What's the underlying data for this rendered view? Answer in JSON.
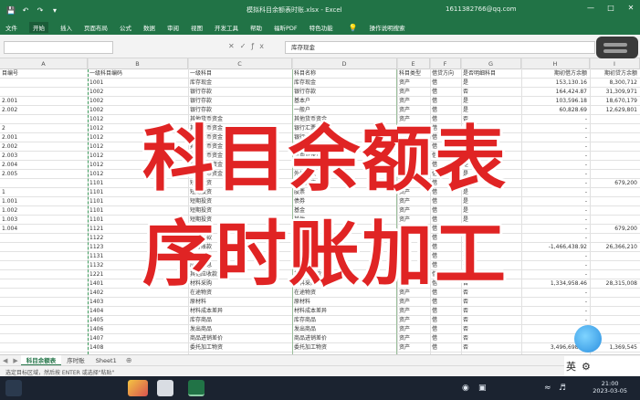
{
  "window": {
    "title": "模拟科目余额表时账.xlsx - Excel",
    "user": "1611382766@qq.com"
  },
  "ribbon": {
    "tabs": [
      "文件",
      "开始",
      "插入",
      "页面布局",
      "公式",
      "数据",
      "审阅",
      "视图",
      "开发工具",
      "帮助",
      "福昕PDF",
      "特色功能",
      "操作说明搜索"
    ]
  },
  "formula_bar": {
    "value": "库存现金"
  },
  "columns": [
    "A",
    "B",
    "C",
    "D",
    "E",
    "F",
    "G",
    "H",
    "I"
  ],
  "grid": {
    "rows": [
      [
        "目编号",
        "一级科目编码",
        "一级科目",
        "科目名称",
        "科目类型",
        "借贷方向",
        "是否明细科目",
        "期初借方余额",
        "期初贷方余额"
      ],
      [
        "",
        "1001",
        "库存现金",
        "库存现金",
        "资产",
        "借",
        "是",
        "153,130.16",
        "8,300,712"
      ],
      [
        "",
        "1002",
        "银行存款",
        "银行存款",
        "资产",
        "借",
        "否",
        "164,424.87",
        "31,309,971"
      ],
      [
        "2.001",
        "1002",
        "银行存款",
        "基本户",
        "资产",
        "借",
        "是",
        "103,596.18",
        "18,670,179"
      ],
      [
        "2.002",
        "1002",
        "银行存款",
        "一般户",
        "资产",
        "借",
        "是",
        "60,828.69",
        "12,629,801"
      ],
      [
        "",
        "1012",
        "其他货币资金",
        "其他货币资金",
        "资产",
        "借",
        "否",
        "-",
        ""
      ],
      [
        "2",
        "1012",
        "其他货币资金",
        "银行汇票",
        "资产",
        "借",
        "是",
        "-",
        ""
      ],
      [
        "2.001",
        "1012",
        "其他货币资金",
        "银行本票",
        "资产",
        "借",
        "是",
        "-",
        ""
      ],
      [
        "2.002",
        "1012",
        "其他货币资金",
        "信用卡存款",
        "资产",
        "借",
        "是",
        "-",
        ""
      ],
      [
        "2.003",
        "1012",
        "其他货币资金",
        "信用证保证金",
        "资产",
        "借",
        "是",
        "-",
        ""
      ],
      [
        "2.004",
        "1012",
        "其他货币资金",
        "存出投资款",
        "资产",
        "借",
        "是",
        "-",
        ""
      ],
      [
        "2.005",
        "1012",
        "其他货币资金",
        "外埠存款",
        "资产",
        "借",
        "是",
        "-",
        ""
      ],
      [
        "",
        "1101",
        "短期投资",
        "短期投资",
        "资产",
        "借",
        "否",
        "-",
        "679,200"
      ],
      [
        "1",
        "1101",
        "短期投资",
        "股票",
        "资产",
        "借",
        "是",
        "-",
        ""
      ],
      [
        "1.001",
        "1101",
        "短期投资",
        "债券",
        "资产",
        "借",
        "是",
        "-",
        ""
      ],
      [
        "1.002",
        "1101",
        "短期投资",
        "基金",
        "资产",
        "借",
        "是",
        "-",
        ""
      ],
      [
        "1.003",
        "1101",
        "短期投资",
        "其他",
        "资产",
        "借",
        "是",
        "-",
        ""
      ],
      [
        "1.004",
        "1121",
        "应收票据",
        "应收票据",
        "资产",
        "借",
        "否",
        "-",
        "679,200"
      ],
      [
        "",
        "1122",
        "应收账款",
        "应收账款",
        "资产",
        "借",
        "否",
        "-",
        ""
      ],
      [
        "",
        "1123",
        "预付账款",
        "预付账款",
        "资产",
        "借",
        "否",
        "-1,466,438.92",
        "26,366,210"
      ],
      [
        "",
        "1131",
        "应收股利",
        "应收股利",
        "资产",
        "借",
        "否",
        "-",
        ""
      ],
      [
        "",
        "1132",
        "应收利息",
        "应收利息",
        "资产",
        "借",
        "否",
        "-",
        ""
      ],
      [
        "",
        "1221",
        "其他应收款",
        "其他应收款",
        "资产",
        "借",
        "否",
        "-",
        ""
      ],
      [
        "",
        "1401",
        "材料采购",
        "材料采购",
        "资产",
        "借",
        "否",
        "1,334,958.46",
        "28,315,008"
      ],
      [
        "",
        "1402",
        "在途物资",
        "在途物资",
        "资产",
        "借",
        "否",
        "-",
        ""
      ],
      [
        "",
        "1403",
        "原材料",
        "原材料",
        "资产",
        "借",
        "否",
        "-",
        ""
      ],
      [
        "",
        "1404",
        "材料成本差异",
        "材料成本差异",
        "资产",
        "借",
        "否",
        "-",
        ""
      ],
      [
        "",
        "1405",
        "库存商品",
        "库存商品",
        "资产",
        "借",
        "否",
        "-",
        ""
      ],
      [
        "",
        "1406",
        "发出商品",
        "发出商品",
        "资产",
        "借",
        "否",
        "-",
        ""
      ],
      [
        "",
        "1407",
        "商品进销差价",
        "商品进销差价",
        "资产",
        "借",
        "否",
        "-",
        ""
      ],
      [
        "",
        "1408",
        "委托加工物资",
        "委托加工物资",
        "资产",
        "借",
        "否",
        "3,496,698.39",
        "1,369,545"
      ]
    ]
  },
  "overlay": {
    "line1": "科目余额表",
    "line2": "序时账加工"
  },
  "sheets": {
    "tabs": [
      "科目余额表",
      "序时账",
      "Sheet1"
    ],
    "active_index": 0
  },
  "status": {
    "text": "选定目标区域，然后按 ENTER 或选择\"粘贴\""
  },
  "ime": {
    "lang": "英",
    "mode": "⚙"
  },
  "clock": {
    "time": "21:00",
    "date": "2023-03-05"
  },
  "colors": {
    "excel_green": "#217346",
    "overlay_red": "#e02424",
    "taskbar": "#1b2330"
  }
}
